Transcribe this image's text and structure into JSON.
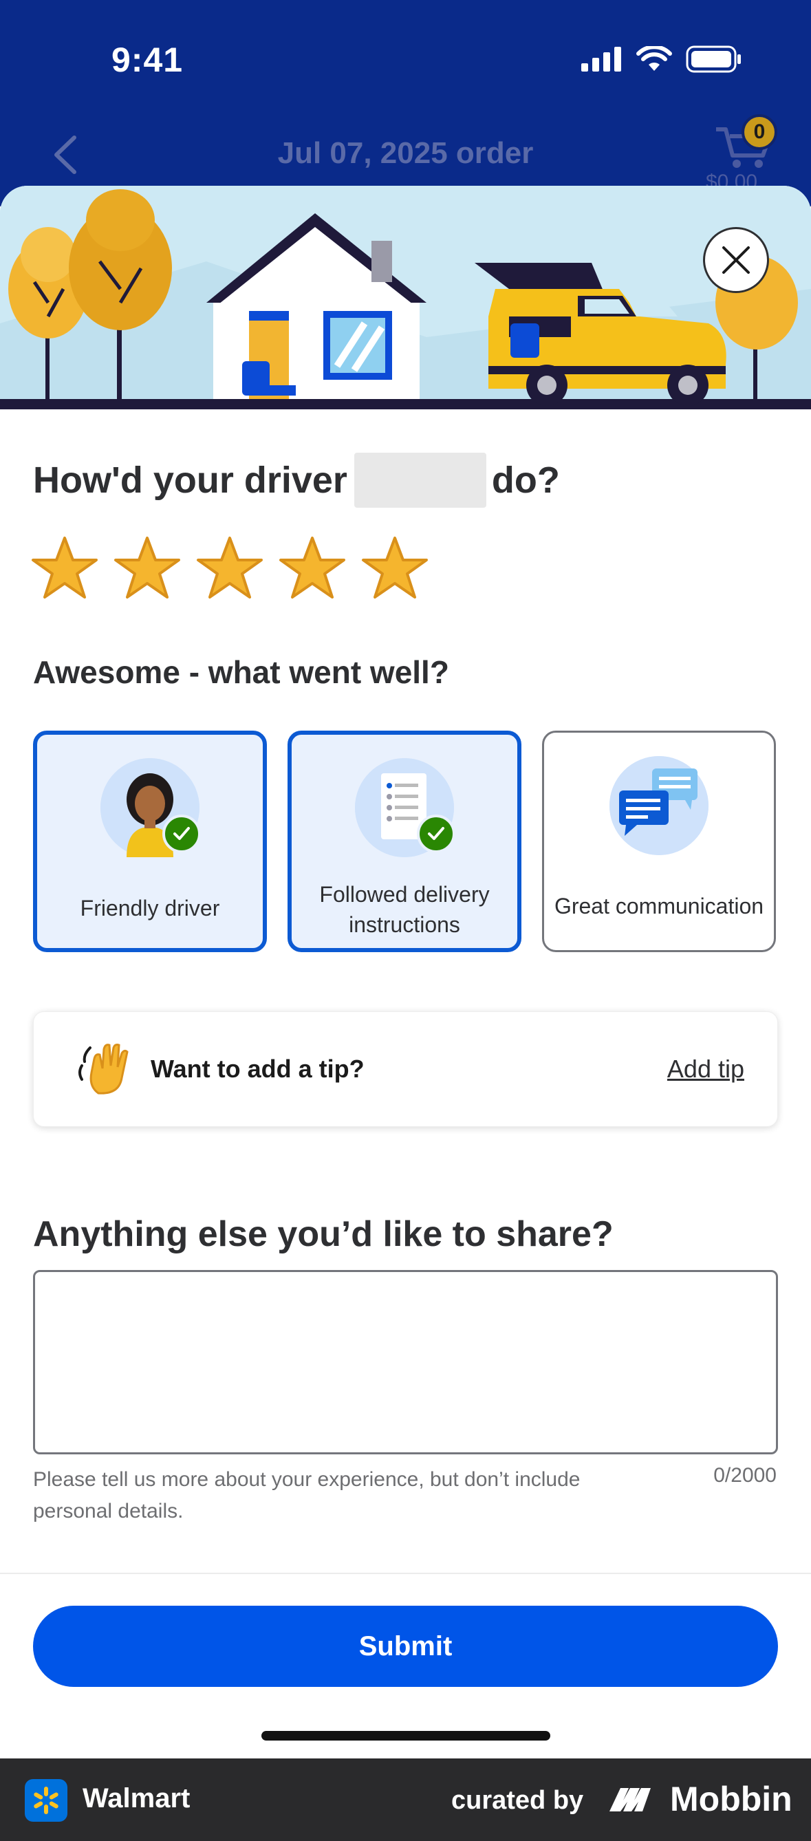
{
  "status_bar": {
    "time": "9:41"
  },
  "nav": {
    "title": "Jul 07, 2025 order",
    "cart_count": "0",
    "cart_total": "$0.00"
  },
  "rating": {
    "question_prefix": "How'd your driver",
    "question_suffix": "do?",
    "stars_selected": 5,
    "stars_total": 5
  },
  "feedback": {
    "title": "Awesome - what went well?",
    "options": [
      {
        "label": "Friendly driver",
        "selected": true
      },
      {
        "label": "Followed delivery instructions",
        "selected": true
      },
      {
        "label": "Great communication",
        "selected": false
      }
    ]
  },
  "tip": {
    "text": "Want to add a tip?",
    "link": "Add tip"
  },
  "share": {
    "title": "Anything else you’d like to share?",
    "value": "",
    "helper": "Please tell us more about your experience, but don’t include personal details.",
    "counter": "0/2000"
  },
  "submit_label": "Submit",
  "brand_bar": {
    "app_name": "Walmart",
    "curated_by": "curated by",
    "mobbin": "Mobbin"
  },
  "colors": {
    "nav": "#0a2a8a",
    "accent": "#0055e8",
    "star": "#f5b52e",
    "selected_border": "#0c5ad3",
    "check": "#2a8703"
  }
}
